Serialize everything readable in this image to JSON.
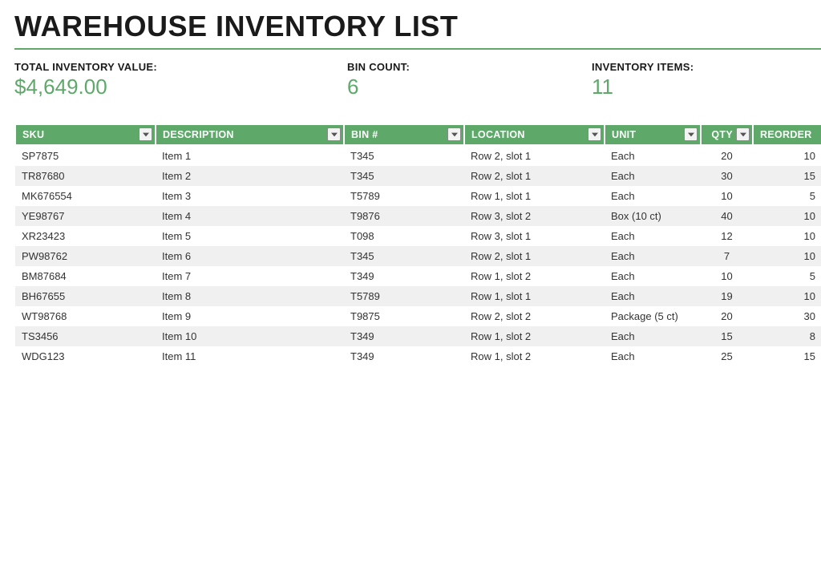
{
  "title": "WAREHOUSE INVENTORY LIST",
  "stats": {
    "total": {
      "label": "TOTAL INVENTORY VALUE:",
      "value": "$4,649.00"
    },
    "bin": {
      "label": "BIN COUNT:",
      "value": "6"
    },
    "items": {
      "label": "INVENTORY ITEMS:",
      "value": "11"
    }
  },
  "columns": {
    "sku": "SKU",
    "description": "DESCRIPTION",
    "bin": "BIN #",
    "location": "LOCATION",
    "unit": "UNIT",
    "qty": "QTY",
    "reorder": "REORDER"
  },
  "rows": [
    {
      "sku": "SP7875",
      "description": "Item 1",
      "bin": "T345",
      "location": "Row 2, slot 1",
      "unit": "Each",
      "qty": "20",
      "reorder": "10"
    },
    {
      "sku": "TR87680",
      "description": "Item 2",
      "bin": "T345",
      "location": "Row 2, slot 1",
      "unit": "Each",
      "qty": "30",
      "reorder": "15"
    },
    {
      "sku": "MK676554",
      "description": "Item 3",
      "bin": "T5789",
      "location": "Row 1, slot 1",
      "unit": "Each",
      "qty": "10",
      "reorder": "5"
    },
    {
      "sku": "YE98767",
      "description": "Item 4",
      "bin": "T9876",
      "location": "Row 3, slot 2",
      "unit": "Box (10 ct)",
      "qty": "40",
      "reorder": "10"
    },
    {
      "sku": "XR23423",
      "description": "Item 5",
      "bin": "T098",
      "location": "Row 3, slot 1",
      "unit": "Each",
      "qty": "12",
      "reorder": "10"
    },
    {
      "sku": "PW98762",
      "description": "Item 6",
      "bin": "T345",
      "location": "Row 2, slot 1",
      "unit": "Each",
      "qty": "7",
      "reorder": "10"
    },
    {
      "sku": "BM87684",
      "description": "Item 7",
      "bin": "T349",
      "location": "Row 1, slot 2",
      "unit": "Each",
      "qty": "10",
      "reorder": "5"
    },
    {
      "sku": "BH67655",
      "description": "Item 8",
      "bin": "T5789",
      "location": "Row 1, slot 1",
      "unit": "Each",
      "qty": "19",
      "reorder": "10"
    },
    {
      "sku": "WT98768",
      "description": "Item 9",
      "bin": "T9875",
      "location": "Row 2, slot 2",
      "unit": "Package (5 ct)",
      "qty": "20",
      "reorder": "30"
    },
    {
      "sku": "TS3456",
      "description": "Item 10",
      "bin": "T349",
      "location": "Row 1, slot 2",
      "unit": "Each",
      "qty": "15",
      "reorder": "8"
    },
    {
      "sku": "WDG123",
      "description": "Item 11",
      "bin": "T349",
      "location": "Row 1, slot 2",
      "unit": "Each",
      "qty": "25",
      "reorder": "15"
    }
  ]
}
